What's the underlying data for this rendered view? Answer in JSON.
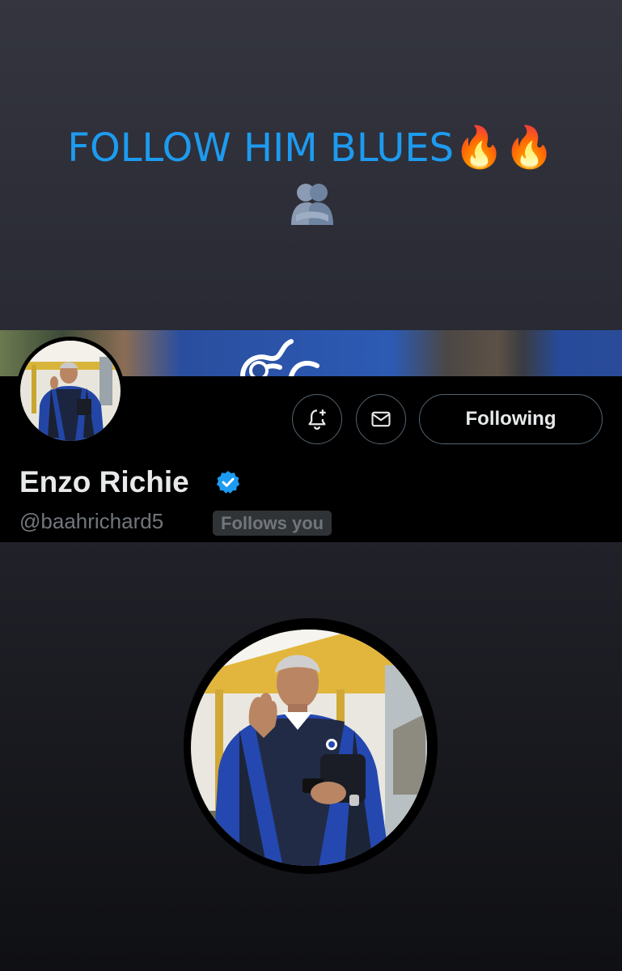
{
  "caption": {
    "text": "FOLLOW HIM BLUES",
    "emojis": "🔥🔥",
    "icon": "people-hugging-icon"
  },
  "profile": {
    "name": "Enzo Richie",
    "handle": "@baahrichard5",
    "follows_you": "Follows you",
    "verified": true,
    "following_label": "Following"
  },
  "icons": {
    "notify": "bell-plus-icon",
    "message": "envelope-icon",
    "verified": "verified-badge-icon"
  },
  "colors": {
    "accent": "#1d9bf0",
    "card_bg": "#000000",
    "text_primary": "#e7e9ea",
    "text_secondary": "#71767b",
    "badge_bg": "#2f3336",
    "border": "#536471"
  }
}
